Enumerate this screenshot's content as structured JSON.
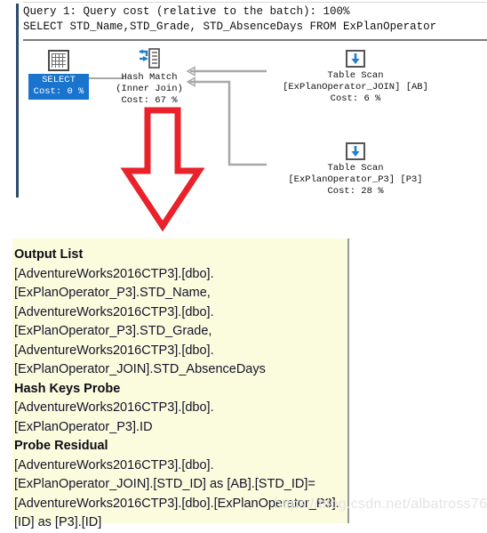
{
  "plan": {
    "header": {
      "cost_line": "Query 1: Query cost (relative to the batch): 100%",
      "sql_line": "SELECT STD_Name,STD_Grade, STD_AbsenceDays FROM ExPlanOperator"
    },
    "nodes": {
      "select": {
        "icon": "result-grid-icon",
        "label": "SELECT",
        "cost": "Cost: 0 %"
      },
      "hash_match": {
        "icon": "hash-match-icon",
        "line1": "Hash Match",
        "line2": "(Inner Join)",
        "line3": "Cost: 67 %"
      },
      "table_scan_join": {
        "icon": "table-scan-icon",
        "line1": "Table Scan",
        "line2": "[ExPlanOperator_JOIN] [AB]",
        "line3": "Cost: 6 %"
      },
      "table_scan_p3": {
        "icon": "table-scan-icon",
        "line1": "Table Scan",
        "line2": "[ExPlanOperator_P3] [P3]",
        "line3": "Cost: 28 %"
      }
    },
    "annotation": {
      "icon": "red-down-arrow-icon",
      "color": "#e8212a"
    }
  },
  "tooltip": {
    "sections": [
      {
        "heading": "Output List",
        "lines": [
          "[AdventureWorks2016CTP3].[dbo].",
          "[ExPlanOperator_P3].STD_Name,",
          "[AdventureWorks2016CTP3].[dbo].",
          "[ExPlanOperator_P3].STD_Grade,",
          "[AdventureWorks2016CTP3].[dbo].",
          "[ExPlanOperator_JOIN].STD_AbsenceDays"
        ]
      },
      {
        "heading": "Hash Keys Probe",
        "lines": [
          "[AdventureWorks2016CTP3].[dbo].",
          "[ExPlanOperator_P3].ID"
        ]
      },
      {
        "heading": "Probe Residual",
        "lines": [
          "[AdventureWorks2016CTP3].[dbo].",
          "[ExPlanOperator_JOIN].[STD_ID] as [AB].[STD_ID]=",
          "[AdventureWorks2016CTP3].[dbo].[ExPlanOperator_P3].",
          "[ID] as [P3].[ID]"
        ]
      }
    ]
  },
  "watermark": {
    "text": "https://blog.csdn.net/albatross76"
  },
  "colors": {
    "select_highlight": "#1874CD",
    "tooltip_bg": "#fbfbdd",
    "annotation_red": "#e8212a",
    "pane_border": "#2e4a6b"
  }
}
